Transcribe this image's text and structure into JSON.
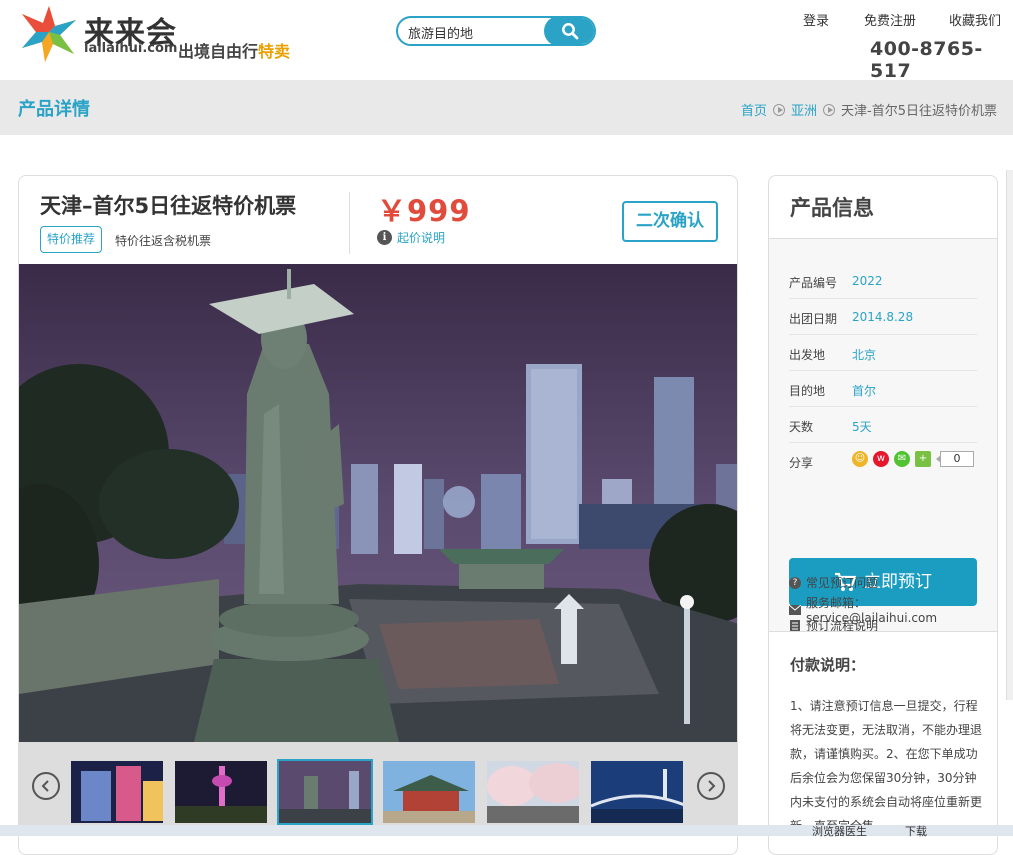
{
  "header": {
    "logo_cn": "来来会",
    "logo_en": "lailaihui.com",
    "slogan_main": "出境自由行",
    "slogan_highlight": "特卖",
    "search_placeholder": "旅游目的地",
    "links": [
      "登录",
      "免费注册",
      "收藏我们"
    ],
    "phone": "400-8765-517"
  },
  "titlebar": {
    "title": "产品详情",
    "breadcrumbs": [
      "首页",
      "亚洲",
      "天津-首尔5日往返特价机票"
    ]
  },
  "product": {
    "title": "天津–首尔5日往返特价机票",
    "tag": "特价推荐",
    "subtitle": "特价往返含税机票",
    "price": "￥999",
    "price_note": "起价说明",
    "confirm_button": "二次确认",
    "thumbnails_count": 6,
    "active_thumbnail": 3
  },
  "sidebar": {
    "title": "产品信息",
    "fields": [
      {
        "key": "产品编号",
        "value": "2022"
      },
      {
        "key": "出团日期",
        "value": "2014.8.28"
      },
      {
        "key": "出发地",
        "value": "北京"
      },
      {
        "key": "目的地",
        "value": "首尔"
      },
      {
        "key": "天数",
        "value": "5天"
      }
    ],
    "share_label": "分享",
    "share_count": "0",
    "book_button": "立即预订",
    "links": [
      "预订流程说明",
      "常见预订问题",
      "服务邮箱：service@lailaihui.com"
    ],
    "pay_title": "付款说明：",
    "pay_text": "1、请注意预订信息一旦提交，行程将无法变更，无法取消，不能办理退款，请谨慎购买。2、在您下单成功后余位会为您保留30分钟，30分钟内未支付的系统会自动将座位重新更新，直至完全售"
  },
  "colors": {
    "accent": "#2aa3c7",
    "price": "#e14b3b",
    "button": "#1b9dc2",
    "titlebar_bg": "#e9e9e9"
  },
  "browser_strip": [
    "浏览器医生",
    "下载"
  ]
}
